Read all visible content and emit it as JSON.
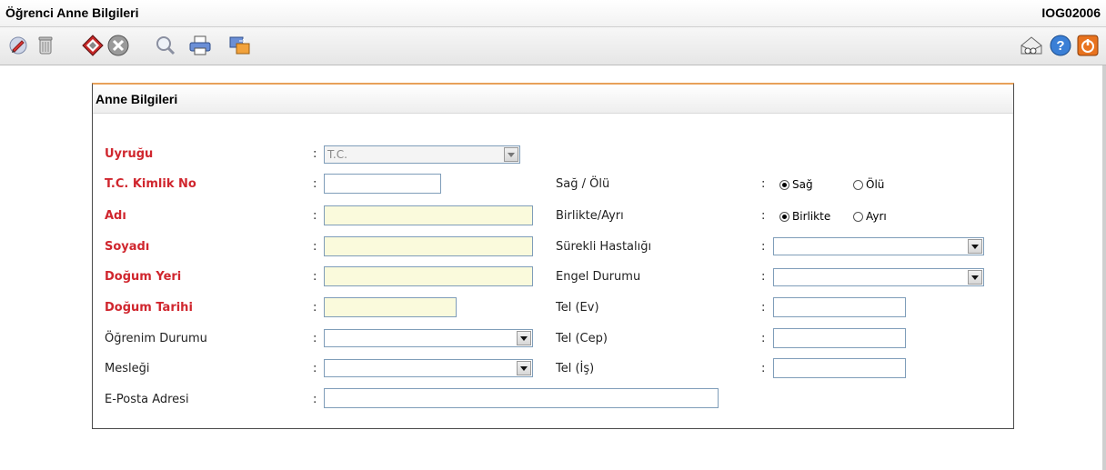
{
  "window": {
    "title": "Öğrenci Anne Bilgileri",
    "code": "IOG02006"
  },
  "toolbar": {
    "left_icons": [
      "edit-icon",
      "delete-icon",
      "save-icon",
      "cancel-icon",
      "search-icon",
      "print-icon",
      "transfer-icon"
    ],
    "right_icons": [
      "mail-icon",
      "help-icon",
      "exit-icon"
    ]
  },
  "panel": {
    "title": "Anne Bilgileri"
  },
  "form": {
    "uyrugu": {
      "label": "Uyruğu",
      "value": "T.C."
    },
    "tc_no": {
      "label": "T.C. Kimlik No",
      "value": ""
    },
    "adi": {
      "label": "Adı",
      "value": ""
    },
    "soyadi": {
      "label": "Soyadı",
      "value": ""
    },
    "dogum_yeri": {
      "label": "Doğum Yeri",
      "value": ""
    },
    "dogum_tarihi": {
      "label": "Doğum Tarihi",
      "value": ""
    },
    "ogrenim": {
      "label": "Öğrenim Durumu",
      "value": ""
    },
    "meslegi": {
      "label": "Mesleği",
      "value": ""
    },
    "eposta": {
      "label": "E-Posta Adresi",
      "value": ""
    },
    "sag_olu": {
      "label": "Sağ / Ölü",
      "options": [
        "Sağ",
        "Ölü"
      ],
      "selected": "Sağ"
    },
    "birlikte": {
      "label": "Birlikte/Ayrı",
      "options": [
        "Birlikte",
        "Ayrı"
      ],
      "selected": "Birlikte"
    },
    "hastalik": {
      "label": "Sürekli Hastalığı",
      "value": ""
    },
    "engel": {
      "label": "Engel Durumu",
      "value": ""
    },
    "tel_ev": {
      "label": "Tel (Ev)",
      "value": ""
    },
    "tel_cep": {
      "label": "Tel (Cep)",
      "value": ""
    },
    "tel_is": {
      "label": "Tel (İş)",
      "value": ""
    },
    "colon": ":"
  },
  "colors": {
    "required": "#d0262e",
    "accent": "#e8a15a",
    "border": "#7f9db9"
  }
}
